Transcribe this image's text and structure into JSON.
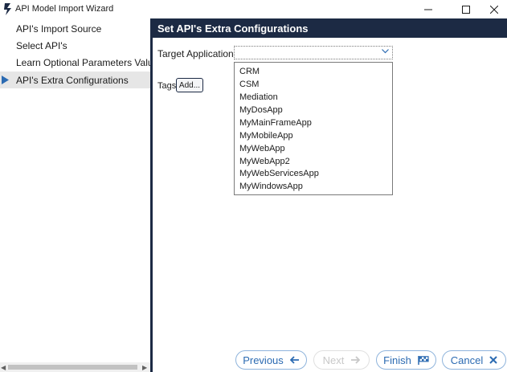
{
  "window": {
    "title": "API Model Import Wizard"
  },
  "steps": [
    {
      "label": "API's Import Source",
      "active": false
    },
    {
      "label": "Select API's",
      "active": false
    },
    {
      "label": "Learn Optional Parameters Values",
      "active": false
    },
    {
      "label": "API's Extra Configurations",
      "active": true
    }
  ],
  "main": {
    "header": "Set API's Extra Configurations",
    "target_label": "Target Application:",
    "target_value": "",
    "options": [
      "CRM",
      "CSM",
      "Mediation",
      "MyDosApp",
      "MyMainFrameApp",
      "MyMobileApp",
      "MyWebApp",
      "MyWebApp2",
      "MyWebServicesApp",
      "MyWindowsApp"
    ],
    "tags_label": "Tags:",
    "add_label": "Add..."
  },
  "footer": {
    "previous": "Previous",
    "next": "Next",
    "finish": "Finish",
    "cancel": "Cancel"
  },
  "colors": {
    "accent": "#1c2a44",
    "button_text": "#2c6bb2",
    "active_step_bg": "#e6e6e6"
  },
  "icons": [
    "app-logo-icon",
    "minimize-icon",
    "maximize-icon",
    "close-icon",
    "step-arrow-icon",
    "chevron-down-icon",
    "arrow-left-icon",
    "arrow-right-icon",
    "flag-icon",
    "x-icon"
  ]
}
